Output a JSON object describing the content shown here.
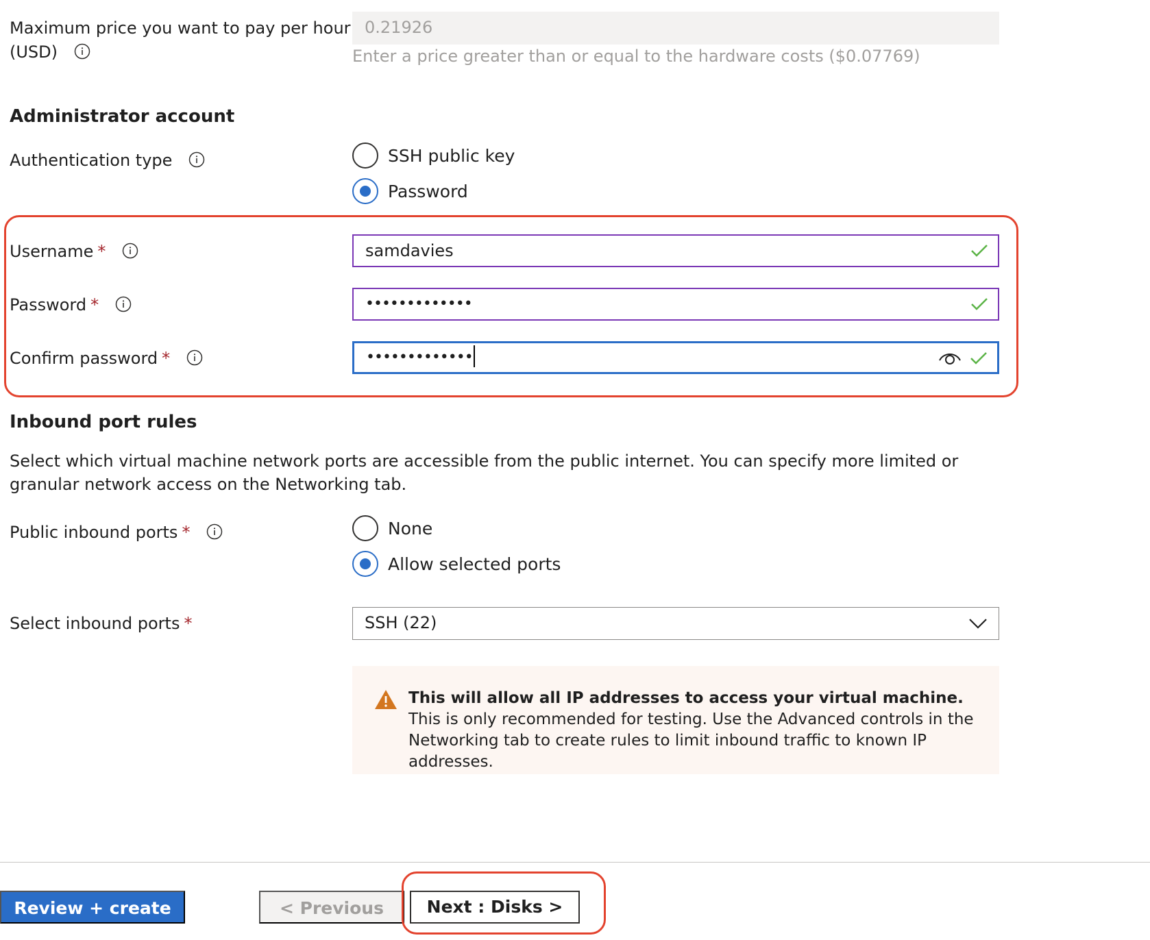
{
  "pricing": {
    "max_price_label_line1": "Maximum price you want to pay per hour",
    "max_price_label_line2": "(USD)",
    "max_price_value": "0.21926",
    "max_price_hint": "Enter a price greater than or equal to the hardware costs ($0.07769)"
  },
  "admin": {
    "heading": "Administrator account",
    "auth_type_label": "Authentication type",
    "auth_options": [
      "SSH public key",
      "Password"
    ],
    "auth_selected": "Password",
    "username_label": "Username",
    "username_value": "samdavies",
    "password_label": "Password",
    "password_mask": "•••••••••••••",
    "confirm_label": "Confirm password",
    "confirm_mask": "•••••••••••••"
  },
  "inbound": {
    "heading": "Inbound port rules",
    "description": "Select which virtual machine network ports are accessible from the public internet. You can specify more limited or granular network access on the Networking tab.",
    "public_ports_label": "Public inbound ports",
    "port_options": [
      "None",
      "Allow selected ports"
    ],
    "port_selected": "Allow selected ports",
    "select_ports_label": "Select inbound ports",
    "select_ports_value": "SSH (22)",
    "warning_bold": "This will allow all IP addresses to access your virtual machine.",
    "warning_text": " This is only recommended for testing.  Use the Advanced controls in the Networking tab to create rules to limit inbound traffic to known IP addresses."
  },
  "footer": {
    "review_label": "Review + create",
    "previous_label": "< Previous",
    "next_label": "Next : Disks >"
  },
  "colors": {
    "accent": "#2a6dc7",
    "valid_border": "#7a37b5",
    "check": "#5bb346",
    "warning": "#d3761f",
    "required": "#a4262c",
    "highlight": "#e3432e"
  }
}
